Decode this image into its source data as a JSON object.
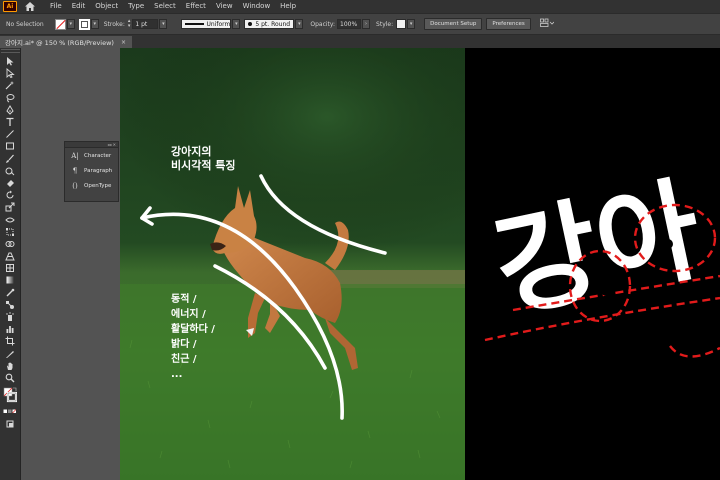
{
  "app": {
    "logo": "Ai"
  },
  "menu": [
    "File",
    "Edit",
    "Object",
    "Type",
    "Select",
    "Effect",
    "View",
    "Window",
    "Help"
  ],
  "control": {
    "selection": "No Selection",
    "stroke_label": "Stroke:",
    "stroke_weight": "1 pt",
    "profile": "Uniform",
    "brush": "5 pt. Round",
    "opacity_label": "Opacity:",
    "opacity": "100%",
    "style_label": "Style:",
    "document_setup": "Document Setup",
    "preferences": "Preferences"
  },
  "tab": {
    "title": "강아지.ai* @ 150 % (RGB/Preview)",
    "close": "×"
  },
  "panel": {
    "collapse": "◂◂ ✕",
    "items": [
      {
        "icon": "A|",
        "label": "Character"
      },
      {
        "icon": "¶",
        "label": "Paragraph"
      },
      {
        "icon": "()",
        "label": "OpenType"
      }
    ]
  },
  "canvas": {
    "title_lines": [
      "강아지의",
      "비시각적 특징"
    ],
    "list_lines": [
      "동적 /",
      "에너지 /",
      "활달하다 /",
      "밝다 /",
      "친근 /",
      "..."
    ],
    "big_text": "강아"
  },
  "colors": {
    "accent": "#e21b1b",
    "menubar": "#323232",
    "controlbar": "#424242",
    "canvas": "#535353"
  }
}
